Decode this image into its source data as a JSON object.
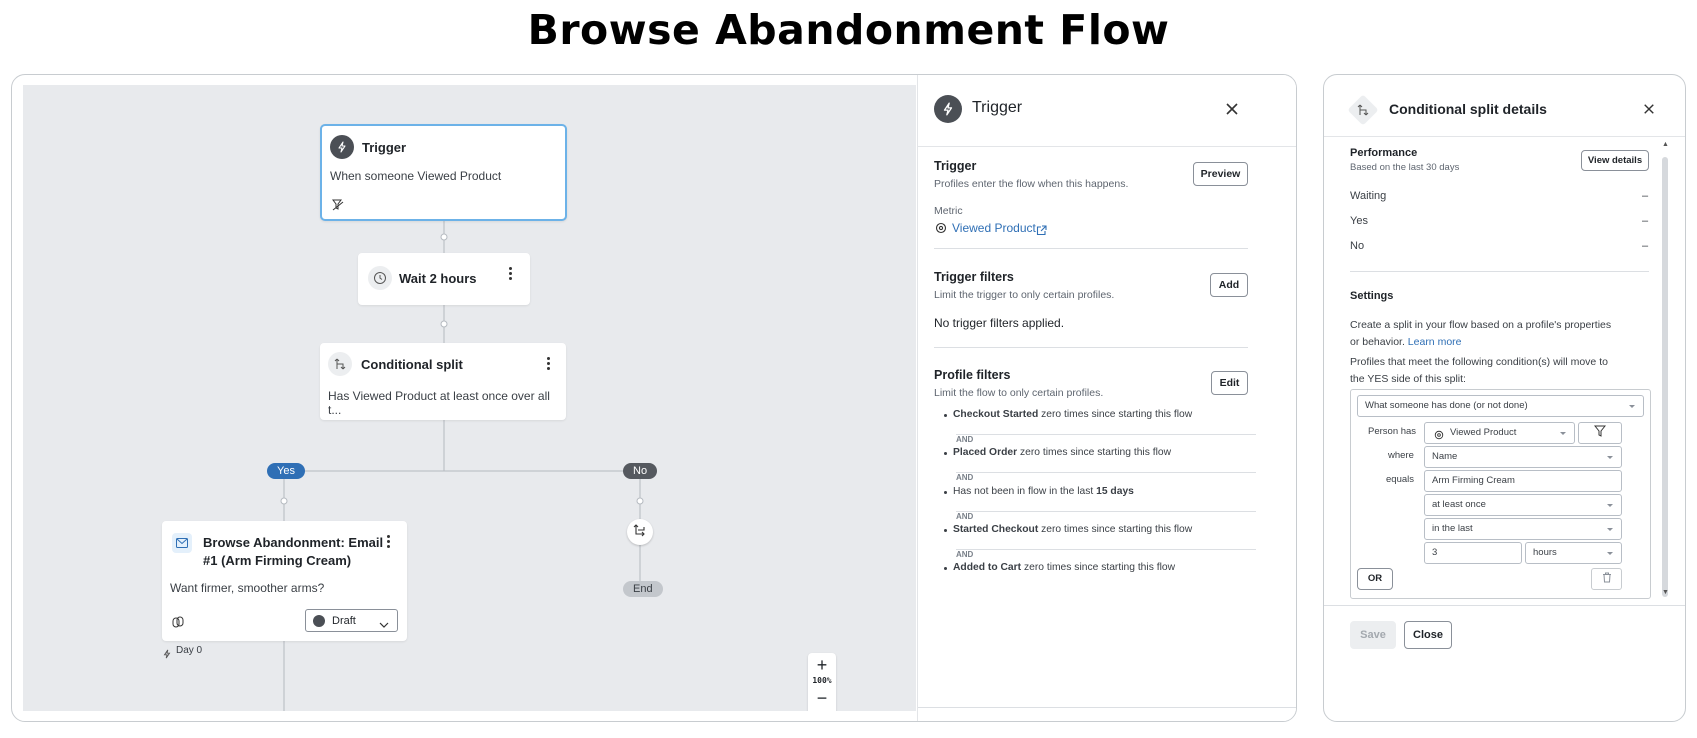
{
  "title": "Browse Abandonment Flow",
  "canvas": {
    "trigger_node": {
      "title": "Trigger",
      "text": "When someone Viewed Product"
    },
    "wait_node": {
      "title": "Wait 2 hours"
    },
    "split_node": {
      "title": "Conditional split",
      "text": "Has Viewed Product at least once over all t..."
    },
    "yes_label": "Yes",
    "no_label": "No",
    "end_label": "End",
    "email_node": {
      "title_line1": "Browse Abandonment: Email",
      "title_line2": "#1 (Arm Firming Cream)",
      "text": "Want firmer, smoother arms?",
      "status": "Draft"
    },
    "day_label": "Day 0",
    "zoom": {
      "plus": "+",
      "level": "100%",
      "minus": "−"
    }
  },
  "trigger_panel": {
    "title": "Trigger",
    "trigger_section": {
      "title": "Trigger",
      "subtitle": "Profiles enter the flow when this happens.",
      "button": "Preview"
    },
    "metric_label": "Metric",
    "metric_value": "Viewed Product",
    "trigger_filters": {
      "title": "Trigger filters",
      "subtitle": "Limit the trigger to only certain profiles.",
      "button": "Add",
      "empty_text": "No trigger filters applied."
    },
    "profile_filters": {
      "title": "Profile filters",
      "subtitle": "Limit the flow to only certain profiles.",
      "button": "Edit",
      "connector": "AND",
      "items": [
        {
          "bold": "Checkout Started",
          "rest": " zero times since starting this flow"
        },
        {
          "bold": "Placed Order",
          "rest": " zero times since starting this flow"
        },
        {
          "prefix": "Has not been in flow in the last ",
          "bold": "15 days"
        },
        {
          "bold": "Started Checkout",
          "rest": " zero times since starting this flow"
        },
        {
          "bold": "Added to Cart",
          "rest": " zero times since starting this flow"
        }
      ]
    }
  },
  "split_details": {
    "title": "Conditional split details",
    "performance": {
      "title": "Performance",
      "subtitle": "Based on the last 30 days",
      "button": "View details"
    },
    "stats": [
      {
        "label": "Waiting",
        "value": "–"
      },
      {
        "label": "Yes",
        "value": "–"
      },
      {
        "label": "No",
        "value": "–"
      }
    ],
    "settings": {
      "title": "Settings",
      "desc_line1": "Create a split in your flow based on a profile's properties",
      "desc_line2_prefix": "or behavior. ",
      "learn_more": "Learn more",
      "cond_line1": "Profiles that meet the following condition(s) will move to",
      "cond_line2": "the YES side of this split:"
    },
    "condition": {
      "type_select": "What someone has done (or not done)",
      "person_has_label": "Person has",
      "metric_select": "Viewed Product",
      "where_label": "where",
      "property_select": "Name",
      "equals_label": "equals",
      "value_input": "Arm Firming Cream",
      "frequency_select": "at least once",
      "time_select": "in the last",
      "count_input": "3",
      "unit_select": "hours",
      "or_button": "OR"
    },
    "save_button": "Save",
    "close_button": "Close"
  }
}
